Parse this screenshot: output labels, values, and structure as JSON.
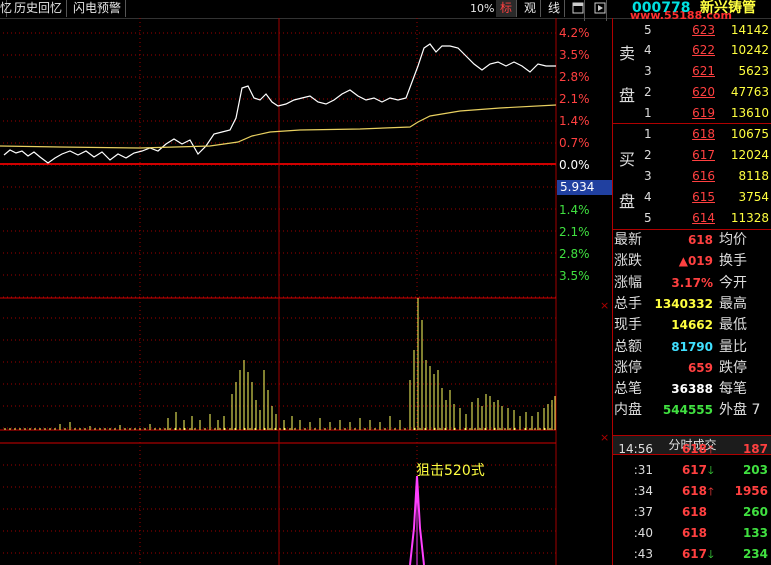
{
  "toolbar": {
    "items": [
      "历史回忆",
      "闪电预警"
    ],
    "lead_glyph": "忆",
    "percent": "10%",
    "mode_labels": [
      "标",
      "观",
      "线"
    ]
  },
  "stock": {
    "code": "000778",
    "name": "新兴铸管",
    "watermark": "www.55188.com"
  },
  "axis_pct": {
    "up": [
      "4.2%",
      "3.5%",
      "2.8%",
      "2.1%",
      "1.4%",
      "0.7%"
    ],
    "zero": "0.0%",
    "down": [
      "1.4%",
      "2.1%",
      "2.8%",
      "3.5%"
    ],
    "price_now": "5.934"
  },
  "annotation": "狙击520式",
  "orderbook": {
    "sell_label": [
      "卖",
      "盘"
    ],
    "buy_label": [
      "买",
      "盘"
    ],
    "sell": [
      {
        "level": "5",
        "price": "623",
        "volume": "14142"
      },
      {
        "level": "4",
        "price": "622",
        "volume": "10242"
      },
      {
        "level": "3",
        "price": "621",
        "volume": "5623"
      },
      {
        "level": "2",
        "price": "620",
        "volume": "47763"
      },
      {
        "level": "1",
        "price": "619",
        "volume": "13610"
      }
    ],
    "buy": [
      {
        "level": "1",
        "price": "618",
        "volume": "10675"
      },
      {
        "level": "2",
        "price": "617",
        "volume": "12024"
      },
      {
        "level": "3",
        "price": "616",
        "volume": "8118"
      },
      {
        "level": "4",
        "price": "615",
        "volume": "3754"
      },
      {
        "level": "5",
        "price": "614",
        "volume": "11328"
      }
    ]
  },
  "stats": [
    {
      "label": "最新",
      "value": "618",
      "color": "#ff4040",
      "label2": "均价"
    },
    {
      "label": "涨跌",
      "value": "▲019",
      "color": "#ff4040",
      "label2": "换手"
    },
    {
      "label": "涨幅",
      "value": "3.17%",
      "color": "#ff4040",
      "label2": "今开"
    },
    {
      "label": "总手",
      "value": "1340332",
      "color": "#ffff40",
      "label2": "最高"
    },
    {
      "label": "现手",
      "value": "14662",
      "color": "#ffff40",
      "label2": "最低"
    },
    {
      "label": "总额",
      "value": "81790",
      "color": "#40e0ff",
      "label2": "量比"
    },
    {
      "label": "涨停",
      "value": "659",
      "color": "#ff4040",
      "label2": "跌停"
    },
    {
      "label": "总笔",
      "value": "36388",
      "color": "#ffffff",
      "label2": "每笔"
    },
    {
      "label": "内盘",
      "value": "544555",
      "color": "#40e040",
      "label2": "外盘 7"
    }
  ],
  "ticks_header": "分时成交",
  "ticks": [
    {
      "time": "14:56",
      "price": "618",
      "dir": "up",
      "vol": "187"
    },
    {
      "time": ":31",
      "price": "617",
      "dir": "down",
      "vol": "203"
    },
    {
      "time": ":34",
      "price": "618",
      "dir": "up",
      "vol": "1956"
    },
    {
      "time": ":37",
      "price": "618",
      "dir": "",
      "vol": "260"
    },
    {
      "time": ":40",
      "price": "618",
      "dir": "",
      "vol": "133"
    },
    {
      "time": ":43",
      "price": "617",
      "dir": "down",
      "vol": "234"
    }
  ],
  "colors": {
    "up": "#ff4040",
    "down": "#40e040",
    "grid": "#a00000",
    "price_line": "#ffffff",
    "avg_line": "#e8d060",
    "volume": "#ffff60",
    "indicator": "#ff40ff"
  }
}
